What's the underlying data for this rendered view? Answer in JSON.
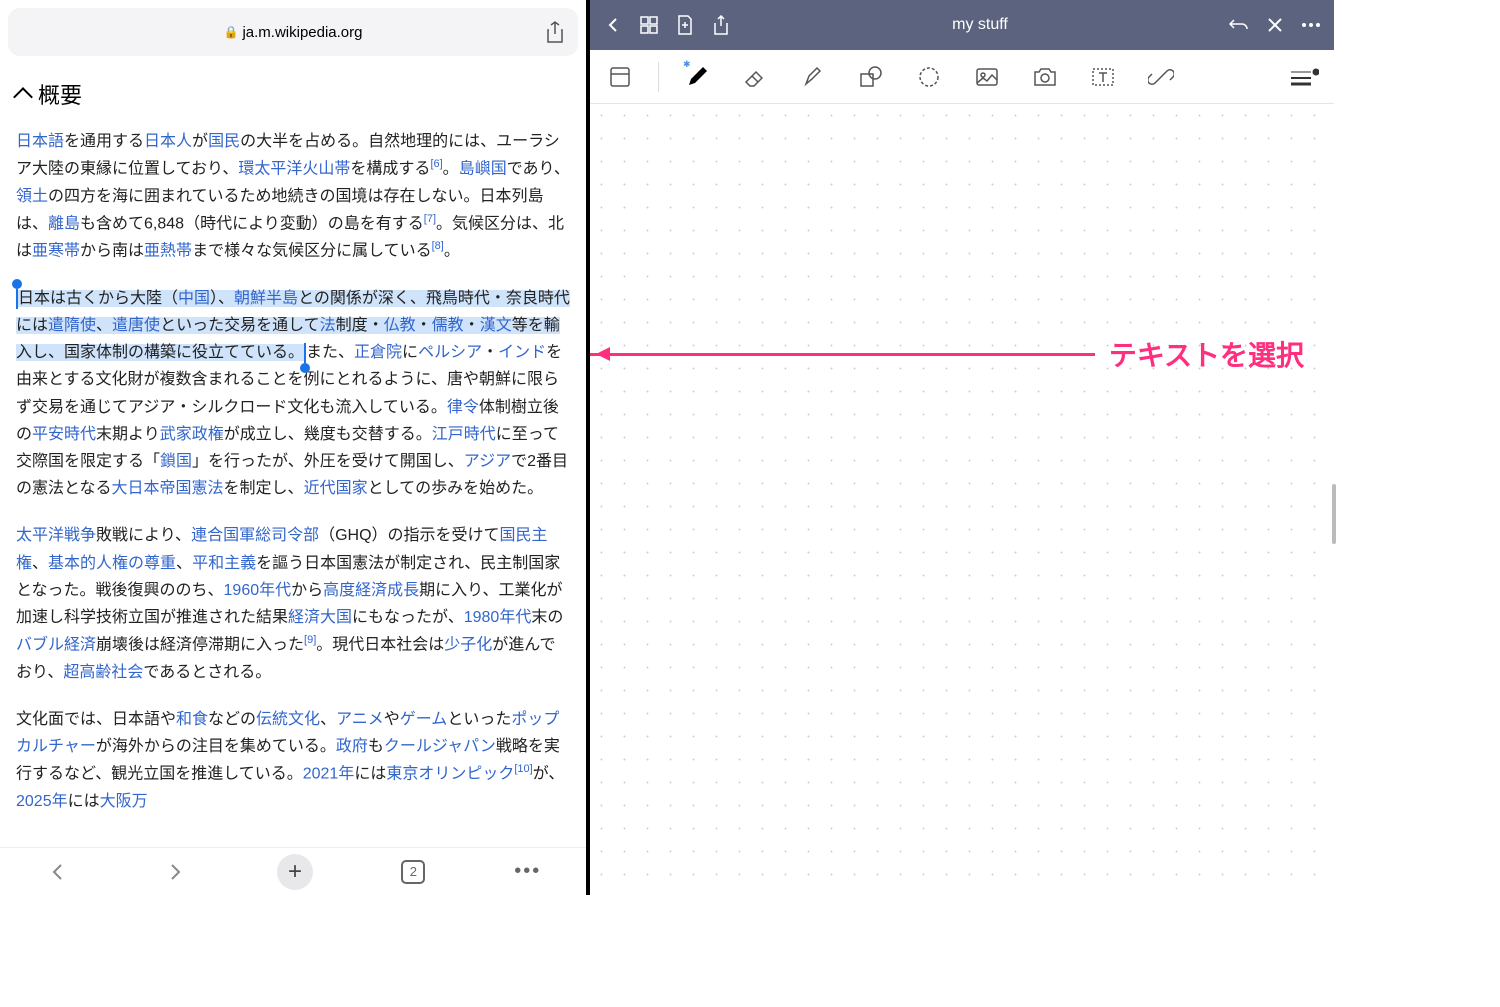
{
  "browser": {
    "url": "ja.m.wikipedia.org",
    "tab_count": "2"
  },
  "section_title": "概要",
  "notes_app": {
    "title": "my stuff"
  },
  "annotation_text": "テキストを選択",
  "paragraphs": {
    "p1": {
      "t1": "日本語",
      "s1": "を通用する",
      "t2": "日本人",
      "s2": "が",
      "t3": "国民",
      "s3": "の大半を占める。自然地理的には、ユーラシア大陸の東縁に位置しており、",
      "t4": "環太平洋火山帯",
      "s4": "を構成する",
      "ref1": "[6]",
      "s5": "。",
      "t5": "島嶼国",
      "s6": "であり、",
      "t6": "領土",
      "s7": "の四方を海に囲まれているため地続きの国境は存在しない。日本列島は、",
      "t7": "離島",
      "s8": "も含めて6,848（時代により変動）の島を有する",
      "ref2": "[7]",
      "s9": "。気候区分は、北は",
      "t8": "亜寒帯",
      "s10": "から南は",
      "t9": "亜熱帯",
      "s11": "まで様々な気候区分に属している",
      "ref3": "[8]",
      "s12": "。"
    },
    "p2": {
      "sel1": "日本は古くから大陸（",
      "sel_t1": "中国",
      "sel2": "）、",
      "sel_t2": "朝鮮半島",
      "sel3": "との関係が深く、飛鳥時代・奈良時代には",
      "sel_t3": "遣隋使",
      "sel4": "、",
      "sel_t4": "遣唐使",
      "sel5": "といった交易を通して",
      "sel_t5": "法",
      "sel6": "制度・",
      "sel_t6": "仏教",
      "sel7": "・",
      "sel_t7": "儒教",
      "sel8": "・",
      "sel_t8": "漢文",
      "sel9": "等を輸入し、国家体制の構築に役立てている。",
      "s1": "また、",
      "t1": "正倉院",
      "s2": "に",
      "t2": "ペルシア",
      "s3": "・",
      "t3": "インド",
      "s4": "を由来とする文化財が複数含まれることを例にとれるように、唐や朝鮮に限らず交易を通じてアジア・シルクロード文化も流入している。",
      "t4": "律令",
      "s5": "体制樹立後の",
      "t5": "平安時代",
      "s6": "末期より",
      "t6": "武家政権",
      "s7": "が成立し、幾度も交替する。",
      "t7": "江戸時代",
      "s8": "に至って交際国を限定する「",
      "t8": "鎖国",
      "s9": "」を行ったが、外圧を受けて開国し、",
      "t9": "アジア",
      "s10": "で2番目の憲法となる",
      "t10": "大日本帝国憲法",
      "s11": "を制定し、",
      "t11": "近代国家",
      "s12": "としての歩みを始めた。"
    },
    "p3": {
      "t1": "太平洋戦争",
      "s1": "敗戦により、",
      "t2": "連合国軍総司令部",
      "s2": "（GHQ）の指示を受けて",
      "t3": "国民主権",
      "s3": "、",
      "t4": "基本的人権の尊重",
      "s4": "、",
      "t5": "平和主義",
      "s5": "を謳う日本国憲法が制定され、民主制国家となった。戦後復興ののち、",
      "t6": "1960年代",
      "s6": "から",
      "t7": "高度経済成長",
      "s7": "期に入り、工業化が加速し科学技術立国が推進された結果",
      "t8": "経済大国",
      "s8": "にもなったが、",
      "t9": "1980年代",
      "s9": "末の",
      "t10": "バブル経済",
      "s10": "崩壊後は経済停滞期に入った",
      "ref1": "[9]",
      "s11": "。現代日本社会は",
      "t11": "少子化",
      "s12": "が進んでおり、",
      "t12": "超高齢社会",
      "s13": "であるとされる。"
    },
    "p4": {
      "s1": "文化面では、日本語や",
      "t1": "和食",
      "s2": "などの",
      "t2": "伝統文化",
      "s3": "、",
      "t3": "アニメ",
      "s4": "や",
      "t4": "ゲーム",
      "s5": "といった",
      "t5": "ポップカルチャー",
      "s6": "が海外からの注目を集めている。",
      "t6": "政府",
      "s7": "も",
      "t7": "クールジャパン",
      "s8": "戦略を実行するなど、観光立国を推進している。",
      "t8": "2021年",
      "s9": "には",
      "t9": "東京オリンピック",
      "ref1": "[10]",
      "s10": "が、",
      "t10": "2025年",
      "s11": "には",
      "t11": "大阪万"
    }
  }
}
